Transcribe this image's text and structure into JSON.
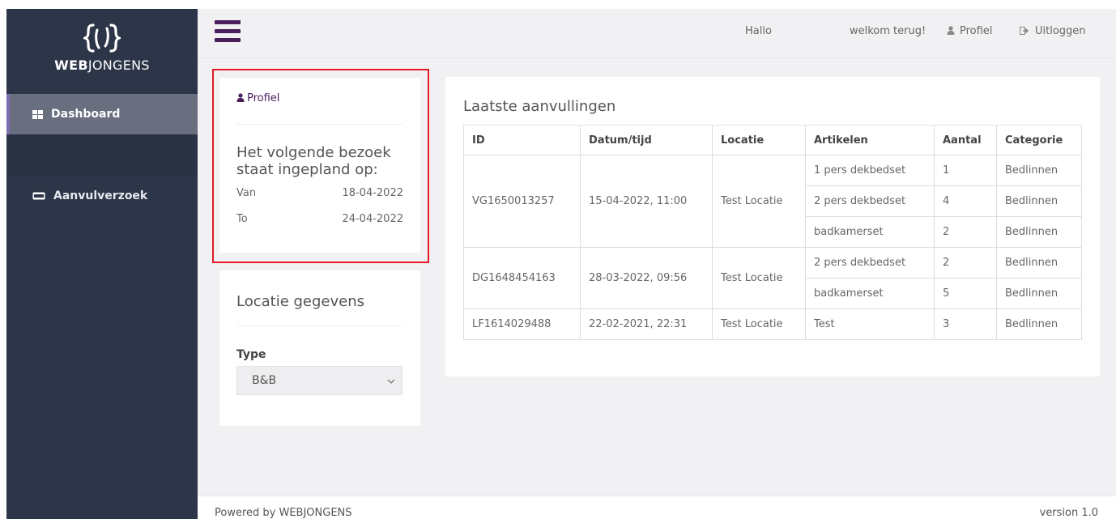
{
  "sidebar": {
    "logo_bold": "WEB",
    "logo_light": "JONGENS",
    "items": [
      {
        "label": "Dashboard",
        "icon": "grid-icon"
      },
      {
        "label": "Aanvulverzoek",
        "icon": "card-icon"
      }
    ]
  },
  "topbar": {
    "hallo": "Hallo",
    "welcome": "welkom terug!",
    "profile": "Profiel",
    "logout": "Uitloggen"
  },
  "profile_card": {
    "link": "Profiel",
    "title": "Het volgende bezoek staat ingepland op:",
    "rows": [
      {
        "label": "Van",
        "value": "18-04-2022"
      },
      {
        "label": "To",
        "value": "24-04-2022"
      }
    ]
  },
  "location_card": {
    "title": "Locatie gegevens",
    "type_label": "Type",
    "type_value": "B&B"
  },
  "table": {
    "title": "Laatste aanvullingen",
    "headers": [
      "ID",
      "Datum/tijd",
      "Locatie",
      "Artikelen",
      "Aantal",
      "Categorie"
    ],
    "groups": [
      {
        "id": "VG1650013257",
        "datetime": "15-04-2022, 11:00",
        "location": "Test Locatie",
        "items": [
          {
            "article": "1 pers dekbedset",
            "qty": "1",
            "category": "Bedlinnen"
          },
          {
            "article": "2 pers dekbedset",
            "qty": "4",
            "category": "Bedlinnen"
          },
          {
            "article": "badkamerset",
            "qty": "2",
            "category": "Bedlinnen"
          }
        ]
      },
      {
        "id": "DG1648454163",
        "datetime": "28-03-2022, 09:56",
        "location": "Test Locatie",
        "items": [
          {
            "article": "2 pers dekbedset",
            "qty": "2",
            "category": "Bedlinnen"
          },
          {
            "article": "badkamerset",
            "qty": "5",
            "category": "Bedlinnen"
          }
        ]
      },
      {
        "id": "LF1614029488",
        "datetime": "22-02-2021, 22:31",
        "location": "Test Locatie",
        "items": [
          {
            "article": "Test",
            "qty": "3",
            "category": "Bedlinnen"
          }
        ]
      }
    ]
  },
  "footer": {
    "powered": "Powered by WEBJONGENS",
    "version": "version 1.0"
  },
  "colors": {
    "sidebar": "#2d3648",
    "accent": "#4a1d5c",
    "highlight": "#e31b23"
  }
}
